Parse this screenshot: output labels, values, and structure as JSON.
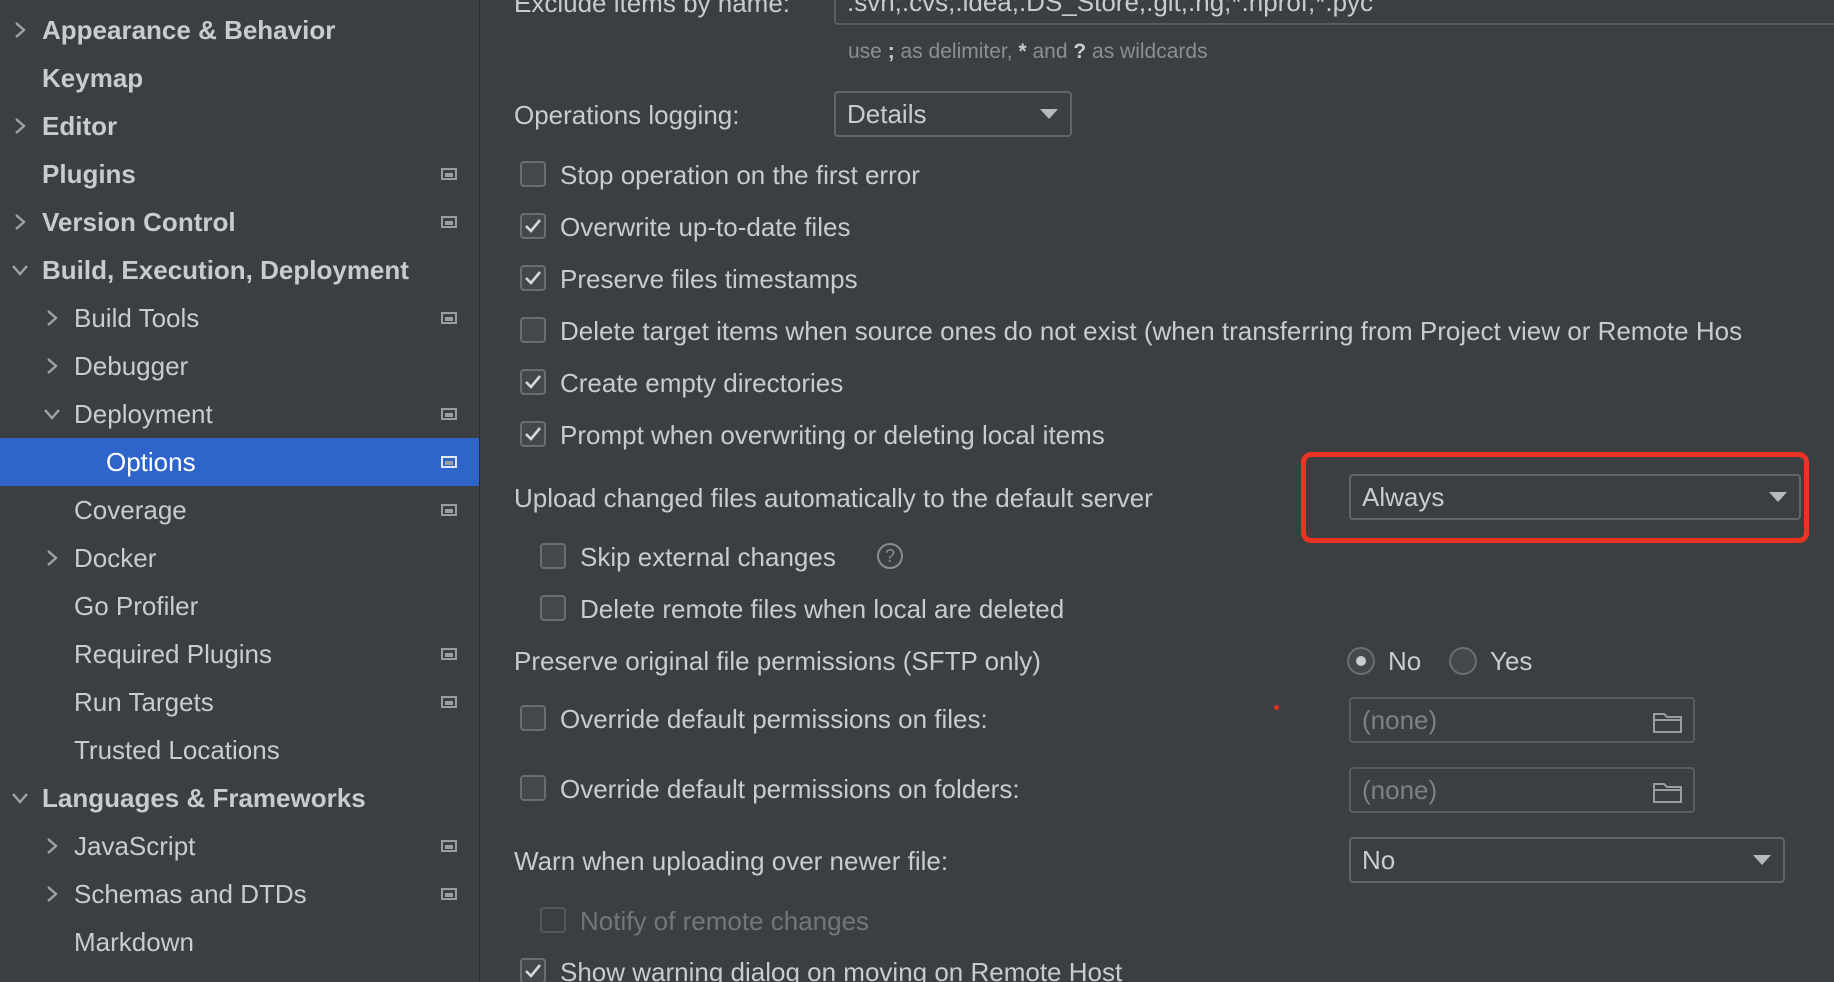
{
  "sidebar": {
    "items": [
      {
        "label": "Appearance & Behavior",
        "chevron": "right"
      },
      {
        "label": "Keymap"
      },
      {
        "label": "Editor",
        "chevron": "right"
      },
      {
        "label": "Plugins"
      },
      {
        "label": "Version Control",
        "chevron": "right"
      },
      {
        "label": "Build, Execution, Deployment",
        "chevron": "down"
      },
      {
        "label": "Build Tools",
        "chevron": "right"
      },
      {
        "label": "Debugger",
        "chevron": "right"
      },
      {
        "label": "Deployment",
        "chevron": "down"
      },
      {
        "label": "Options",
        "selected": true
      },
      {
        "label": "Coverage"
      },
      {
        "label": "Docker",
        "chevron": "right"
      },
      {
        "label": "Go Profiler"
      },
      {
        "label": "Required Plugins"
      },
      {
        "label": "Run Targets"
      },
      {
        "label": "Trusted Locations"
      },
      {
        "label": "Languages & Frameworks",
        "chevron": "down"
      },
      {
        "label": "JavaScript",
        "chevron": "right"
      },
      {
        "label": "Schemas and DTDs",
        "chevron": "right"
      },
      {
        "label": "Markdown"
      }
    ]
  },
  "options": {
    "exclude_label": "Exclude items by name:",
    "exclude_value": ".svn;.cvs;.idea;.DS_Store;.git;.hg;*.hprof;*.pyc",
    "hint_use": "use",
    "hint_semicolon": ";",
    "hint_as_delimiter": "as delimiter,",
    "hint_star": "*",
    "hint_and": "and",
    "hint_question": "?",
    "hint_as_wildcards": "as wildcards",
    "ops_logging_label": "Operations logging:",
    "ops_logging_value": "Details",
    "stop_on_error": "Stop operation on the first error",
    "overwrite_uptodate": "Overwrite up-to-date files",
    "preserve_timestamps": "Preserve files timestamps",
    "delete_target": "Delete target items when source ones do not exist (when transferring from Project view or Remote Hos",
    "create_empty_dirs": "Create empty directories",
    "prompt_overwrite": "Prompt when overwriting or deleting local items",
    "upload_auto_label": "Upload changed files automatically to the default server",
    "upload_auto_value": "Always",
    "skip_external": "Skip external changes",
    "help_glyph": "?",
    "delete_remote": "Delete remote files when local are deleted",
    "preserve_perm_label": "Preserve original file permissions (SFTP only)",
    "radio_no": "No",
    "radio_yes": "Yes",
    "override_files": "Override default permissions on files:",
    "override_files_value": "(none)",
    "override_folders": "Override default permissions on folders:",
    "override_folders_value": "(none)",
    "warn_newer_label": "Warn when uploading over newer file:",
    "warn_newer_value": "No",
    "notify_remote": "Notify of remote changes",
    "show_warning_dialog": "Show warning dialog on moving on Remote Host"
  },
  "colors": {
    "selection": "#2f65ca",
    "highlight_box": "#ea3323",
    "background": "#3c3f41"
  }
}
